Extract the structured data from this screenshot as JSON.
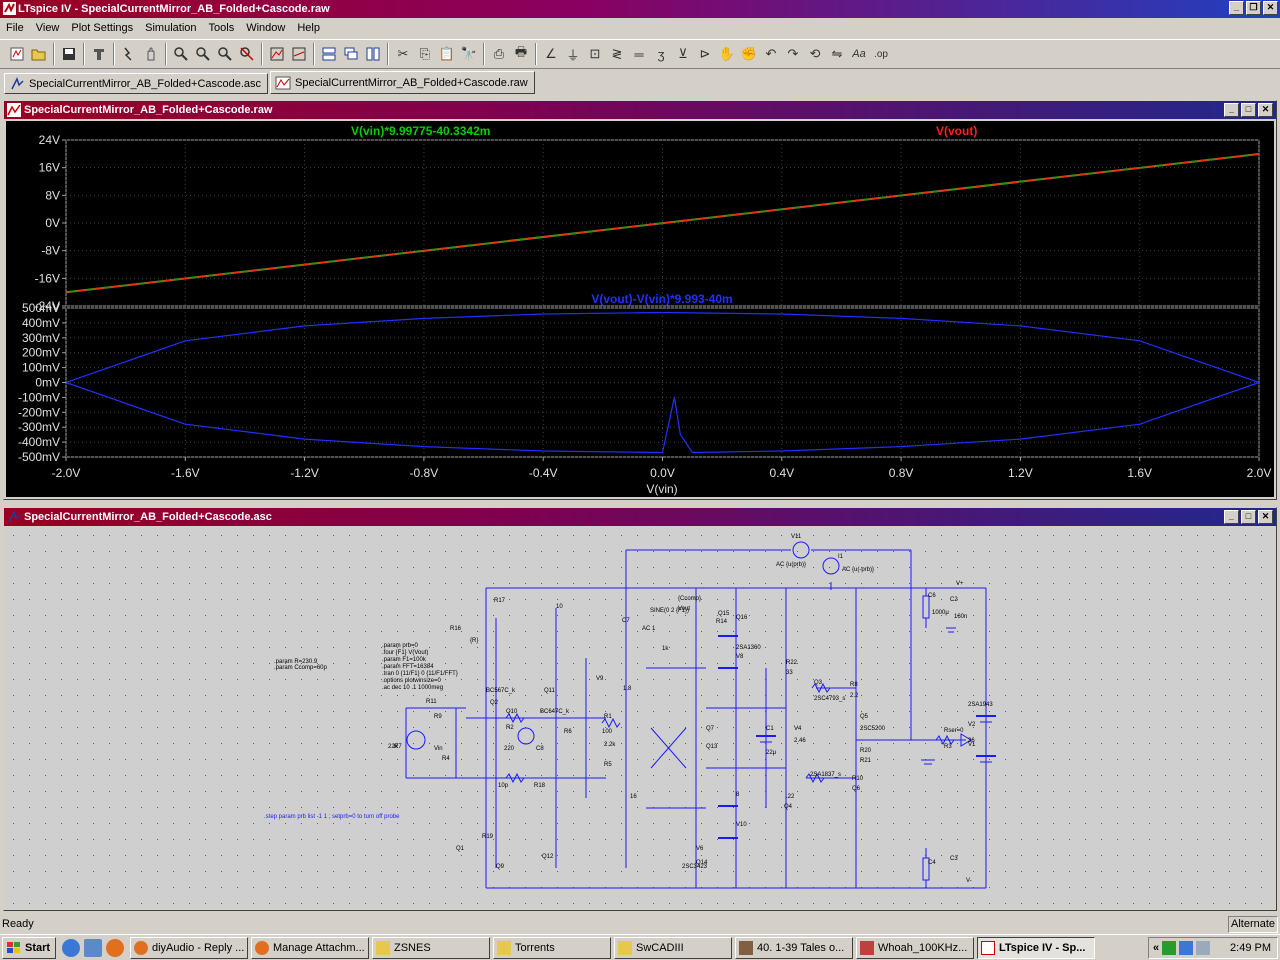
{
  "app": {
    "title": "LTspice IV - SpecialCurrentMirror_AB_Folded+Cascode.raw"
  },
  "menu": [
    "File",
    "View",
    "Plot Settings",
    "Simulation",
    "Tools",
    "Window",
    "Help"
  ],
  "toolbar_icons": [
    "schematic-icon",
    "open-icon",
    "save-icon",
    "control-panel-icon",
    "run-icon",
    "halt-icon",
    "zoom-in-icon",
    "zoom-area-icon",
    "zoom-out-icon",
    "zoom-cancel-icon",
    "autorange-icon",
    "fit-icon",
    "tile-horizontal-icon",
    "cascade-icon",
    "tile-vertical-icon",
    "cut-icon",
    "copy-icon",
    "paste-icon",
    "find-icon",
    "print-preview-icon",
    "print-icon",
    "wire-icon",
    "ground-icon",
    "label-icon",
    "resistor-icon",
    "capacitor-icon",
    "inductor-icon",
    "diode-icon",
    "component-icon",
    "move-icon",
    "drag-icon",
    "undo-icon",
    "redo-icon",
    "rotate-icon",
    "mirror-icon",
    "text-icon",
    "spice-directive-icon"
  ],
  "tabs": [
    {
      "label": "SpecialCurrentMirror_AB_Folded+Cascode.asc"
    },
    {
      "label": "SpecialCurrentMirror_AB_Folded+Cascode.raw"
    }
  ],
  "plot_window": {
    "title": "SpecialCurrentMirror_AB_Folded+Cascode.raw",
    "top_pane": {
      "trace1_label": "V(vin)*9.99775-40.3342m",
      "trace1_color": "#00d000",
      "trace2_label": "V(vout)",
      "trace2_color": "#ff2020",
      "y_ticks": [
        "24V",
        "16V",
        "8V",
        "0V",
        "-8V",
        "-16V",
        "-24V"
      ]
    },
    "bottom_pane": {
      "trace_label": "V(vout)-V(vin)*9.993-40m",
      "trace_color": "#2030ff",
      "y_ticks": [
        "500mV",
        "400mV",
        "300mV",
        "200mV",
        "100mV",
        "0mV",
        "-100mV",
        "-200mV",
        "-300mV",
        "-400mV",
        "-500mV"
      ]
    },
    "x_ticks": [
      "-2.0V",
      "-1.6V",
      "-1.2V",
      "-0.8V",
      "-0.4V",
      "0.0V",
      "0.4V",
      "0.8V",
      "1.2V",
      "1.6V",
      "2.0V"
    ],
    "x_label": "V(vin)"
  },
  "chart_data": [
    {
      "type": "line",
      "xlabel": "V(vin)",
      "xlim": [
        -2.0,
        2.0
      ],
      "ylim": [
        -24,
        24
      ],
      "yunit": "V",
      "series": [
        {
          "name": "V(vin)*9.99775-40.3342m",
          "x": [
            -2.0,
            2.0
          ],
          "y": [
            -20.04,
            19.95
          ]
        },
        {
          "name": "V(vout)",
          "x": [
            -2.0,
            2.0
          ],
          "y": [
            -20.04,
            19.95
          ]
        }
      ]
    },
    {
      "type": "line",
      "xlabel": "V(vin)",
      "xlim": [
        -2.0,
        2.0
      ],
      "ylim": [
        -0.5,
        0.5
      ],
      "yunit": "V",
      "series": [
        {
          "name": "V(vout)-V(vin)*9.993-40m",
          "x": [
            -2.0,
            -1.6,
            -1.2,
            -0.8,
            -0.4,
            0.0,
            0.4,
            0.8,
            1.2,
            1.6,
            2.0
          ],
          "y": [
            0.0,
            0.28,
            0.38,
            0.43,
            0.46,
            0.47,
            0.46,
            0.43,
            0.38,
            0.28,
            0.0
          ]
        },
        {
          "name": "V(vout)-V(vin)*9.993-40m",
          "x": [
            -2.0,
            -1.6,
            -1.2,
            -0.8,
            -0.4,
            0.0,
            0.04,
            0.06,
            0.1,
            0.4,
            0.8,
            1.2,
            1.6,
            2.0
          ],
          "y": [
            0.0,
            -0.28,
            -0.38,
            -0.43,
            -0.46,
            -0.47,
            -0.1,
            -0.35,
            -0.47,
            -0.46,
            -0.43,
            -0.38,
            -0.28,
            0.0
          ]
        }
      ]
    }
  ],
  "schematic_window": {
    "title": "SpecialCurrentMirror_AB_Folded+Cascode.asc",
    "directives": [
      ".param R=230.9",
      ".param Ccomp=60p",
      ".param prb=0",
      ".four {F1} V(Vout)",
      ".param F1=100k",
      ".param FFT=16384",
      ".tran 0 {11/F1} 0 {11/F1/FFT}",
      ".options plotwinsize=0",
      ".ac dec 10 .1 1000meg",
      ".step param prb list -1 1 ; setprb=0 to turn off probe"
    ],
    "labels": [
      "V11",
      "I1",
      "AC {u(prb)}",
      "AC {u(-prb)}",
      "V+",
      "V-",
      "C6",
      "C2",
      "1000μ",
      "160n",
      "C4",
      "C3",
      "R17",
      "10",
      "R16",
      "{R}",
      "BC567C_k",
      "Q11",
      "Q2",
      "Q10",
      "BC647C_k",
      "R2",
      "R1",
      "100",
      "R6",
      "2.2k",
      "R5",
      "220",
      "C8",
      "10p",
      "R18",
      "R19",
      "Q1",
      "Q9",
      "Q12",
      "R11",
      "R9",
      "Vin",
      "R4",
      "R7",
      "22k",
      "SINE(0 2 {F1})",
      "AC 1",
      "C7",
      "{Ccomp}",
      "Vout",
      "R14",
      "1k",
      "Q15",
      "Q16",
      "2SA1360",
      "V8",
      "V9",
      "1.8",
      "16",
      "Q7",
      "Q13",
      "C1",
      "22μ",
      "V4",
      "2.46",
      "R22",
      "33",
      "Q3",
      "2SC4793_s",
      "R8",
      "2.2",
      "Q5",
      "2SC5200",
      "R20",
      "R21",
      ".22",
      "Q4",
      "2SA1837_s",
      "R10",
      "Q6",
      "2SA1943",
      "V1",
      "V2",
      "36",
      "Rser=0",
      "R3",
      "8",
      "V10",
      "V6",
      "Q14",
      "2SC3423",
      "R15"
    ],
    "status": "Ready",
    "status_right": "Alternate"
  },
  "taskbar": {
    "start": "Start",
    "quick_launch": [
      "ie-icon",
      "desktop-icon",
      "firefox-icon"
    ],
    "items": [
      {
        "label": "diyAudio - Reply ...",
        "icon": "firefox-icon"
      },
      {
        "label": "Manage Attachm...",
        "icon": "firefox-icon"
      },
      {
        "label": "ZSNES",
        "icon": "folder-icon"
      },
      {
        "label": "Torrents",
        "icon": "folder-icon"
      },
      {
        "label": "SwCADIII",
        "icon": "folder-icon"
      },
      {
        "label": "40. 1-39 Tales o...",
        "icon": "media-icon"
      },
      {
        "label": "Whoah_100KHz...",
        "icon": "paint-icon"
      },
      {
        "label": "LTspice IV - Sp...",
        "icon": "ltspice-icon",
        "active": true
      }
    ],
    "clock": "2:49 PM"
  }
}
